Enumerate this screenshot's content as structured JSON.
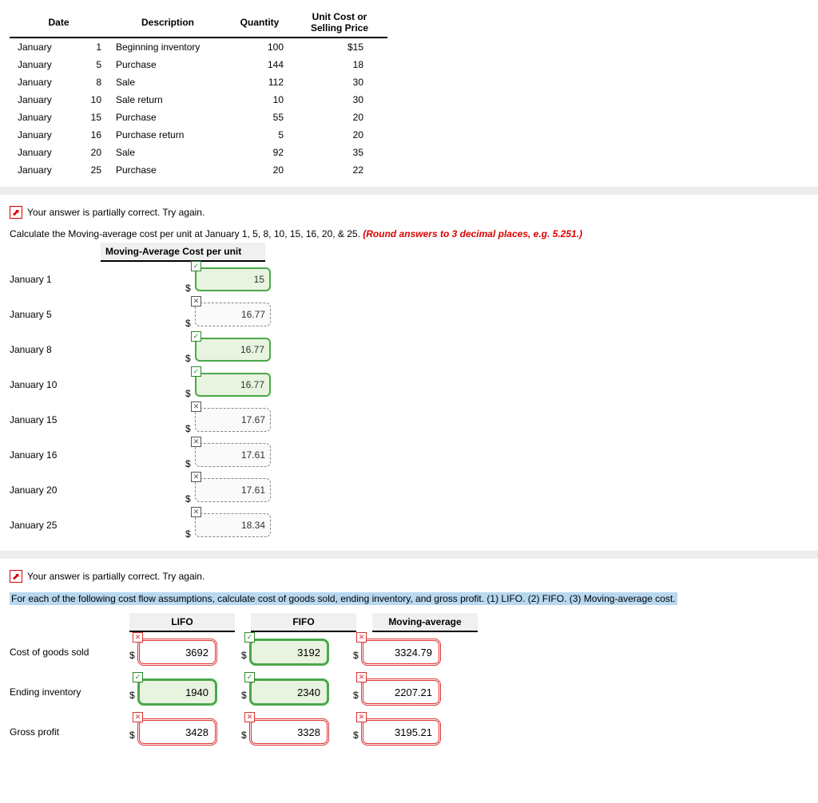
{
  "top_table": {
    "headers": {
      "date": "Date",
      "description": "Description",
      "quantity": "Quantity",
      "price": "Unit Cost or Selling Price"
    },
    "rows": [
      {
        "month": "January",
        "day": "1",
        "desc": "Beginning inventory",
        "qty": "100",
        "price": "$15"
      },
      {
        "month": "January",
        "day": "5",
        "desc": "Purchase",
        "qty": "144",
        "price": "18"
      },
      {
        "month": "January",
        "day": "8",
        "desc": "Sale",
        "qty": "112",
        "price": "30"
      },
      {
        "month": "January",
        "day": "10",
        "desc": "Sale return",
        "qty": "10",
        "price": "30"
      },
      {
        "month": "January",
        "day": "15",
        "desc": "Purchase",
        "qty": "55",
        "price": "20"
      },
      {
        "month": "January",
        "day": "16",
        "desc": "Purchase return",
        "qty": "5",
        "price": "20"
      },
      {
        "month": "January",
        "day": "20",
        "desc": "Sale",
        "qty": "92",
        "price": "35"
      },
      {
        "month": "January",
        "day": "25",
        "desc": "Purchase",
        "qty": "20",
        "price": "22"
      }
    ]
  },
  "feedback_text": "Your answer is partially correct.  Try again.",
  "ma_prompt_plain": "Calculate the Moving-average cost per unit at January 1, 5, 8, 10, 15, 16, 20, & 25. ",
  "ma_prompt_red": "(Round answers to 3 decimal places, e.g. 5.251.)",
  "ma_header": "Moving-Average Cost per unit",
  "dollar": "$",
  "ma_rows": [
    {
      "label": "January 1",
      "value": "15",
      "correct": true
    },
    {
      "label": "January 5",
      "value": "16.77",
      "correct": false
    },
    {
      "label": "January 8",
      "value": "16.77",
      "correct": true
    },
    {
      "label": "January 10",
      "value": "16.77",
      "correct": true
    },
    {
      "label": "January 15",
      "value": "17.67",
      "correct": false
    },
    {
      "label": "January 16",
      "value": "17.61",
      "correct": false
    },
    {
      "label": "January 20",
      "value": "17.61",
      "correct": false
    },
    {
      "label": "January 25",
      "value": "18.34",
      "correct": false
    }
  ],
  "cf_prompt": "For each of the following cost flow assumptions, calculate cost of goods sold, ending inventory, and gross profit. (1) LIFO. (2) FIFO. (3) Moving-average cost.",
  "cf_headers": {
    "lifo": "LIFO",
    "fifo": "FIFO",
    "ma": "Moving-average"
  },
  "cf_rows": [
    {
      "label": "Cost of goods sold",
      "lifo": {
        "v": "3692",
        "ok": false
      },
      "fifo": {
        "v": "3192",
        "ok": true
      },
      "ma": {
        "v": "3324.79",
        "ok": false
      }
    },
    {
      "label": "Ending inventory",
      "lifo": {
        "v": "1940",
        "ok": true
      },
      "fifo": {
        "v": "2340",
        "ok": true
      },
      "ma": {
        "v": "2207.21",
        "ok": false
      }
    },
    {
      "label": "Gross profit",
      "lifo": {
        "v": "3428",
        "ok": false
      },
      "fifo": {
        "v": "3328",
        "ok": false
      },
      "ma": {
        "v": "3195.21",
        "ok": false
      }
    }
  ]
}
